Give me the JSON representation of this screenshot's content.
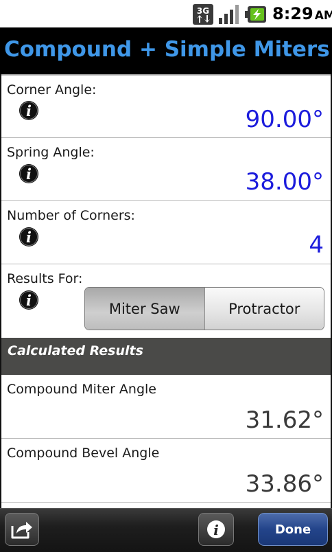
{
  "status_bar": {
    "network": "3G",
    "time": "8:29",
    "ampm": "AM",
    "icons": [
      "3g-data-icon",
      "signal-strength-icon",
      "battery-charging-icon"
    ]
  },
  "title_bar": {
    "title": "Compound + Simple Miters"
  },
  "inputs": {
    "corner_angle": {
      "label": "Corner Angle:",
      "value": "90.00°"
    },
    "spring_angle": {
      "label": "Spring Angle:",
      "value": "38.00°"
    },
    "number_of_corners": {
      "label": "Number of Corners:",
      "value": "4"
    },
    "results_for": {
      "label": "Results For:",
      "options": [
        "Miter Saw",
        "Protractor"
      ],
      "selected": "Miter Saw"
    }
  },
  "results_section": {
    "header": "Calculated Results",
    "items": [
      {
        "label": "Compound Miter Angle",
        "value": "31.62°"
      },
      {
        "label": "Compound Bevel Angle",
        "value": "33.86°"
      }
    ]
  },
  "bottom_bar": {
    "done_label": "Done"
  },
  "colors": {
    "title_text": "#3f97e8",
    "input_value": "#1c1cdc",
    "result_value": "#3a3a3a",
    "section_header_bg": "#4a4a48",
    "done_button": "#23448a"
  }
}
